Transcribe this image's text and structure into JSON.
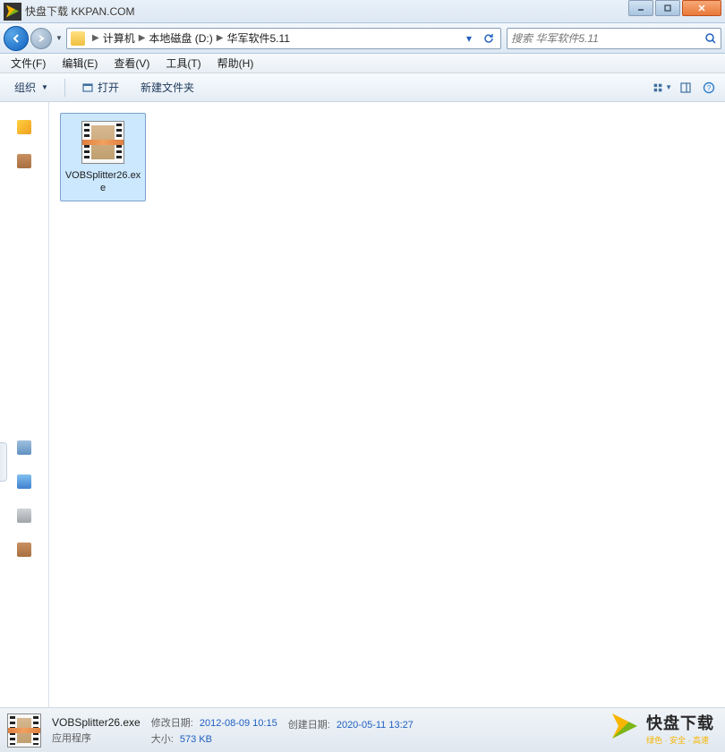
{
  "titlebar": {
    "text": "快盘下载 KKPAN.COM"
  },
  "nav": {
    "breadcrumb": [
      "计算机",
      "本地磁盘 (D:)",
      "华军软件5.11"
    ],
    "search_placeholder": "搜索 华军软件5.11"
  },
  "menubar": {
    "items": [
      "文件(F)",
      "编辑(E)",
      "查看(V)",
      "工具(T)",
      "帮助(H)"
    ]
  },
  "toolbar": {
    "organize": "组织",
    "open": "打开",
    "newfolder": "新建文件夹"
  },
  "file": {
    "name": "VOBSplitter26.exe"
  },
  "details": {
    "filename": "VOBSplitter26.exe",
    "filetype": "应用程序",
    "modified_label": "修改日期:",
    "modified_value": "2012-08-09 10:15",
    "created_label": "创建日期:",
    "created_value": "2020-05-11 13:27",
    "size_label": "大小:",
    "size_value": "573 KB"
  },
  "footer": {
    "title": "快盘下载",
    "subtitle": "绿色 · 安全 · 高速"
  }
}
